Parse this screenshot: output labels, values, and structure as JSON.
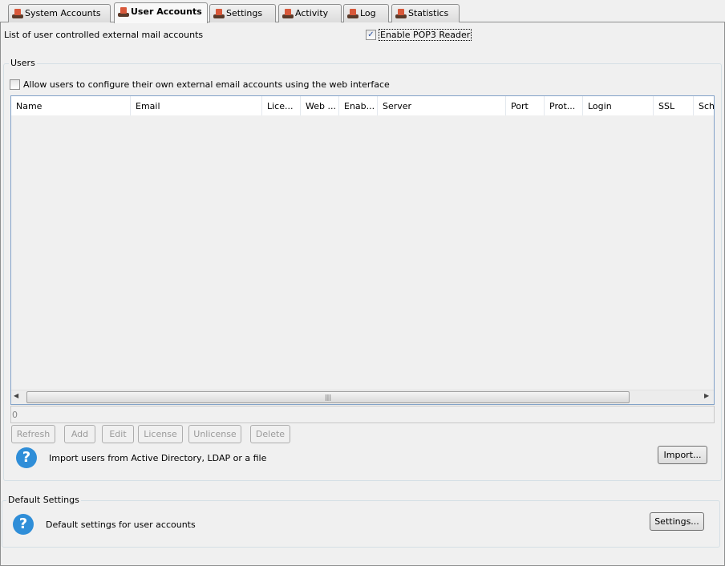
{
  "tabs": [
    {
      "label": "System Accounts"
    },
    {
      "label": "User Accounts",
      "active": true
    },
    {
      "label": "Settings"
    },
    {
      "label": "Activity"
    },
    {
      "label": "Log"
    },
    {
      "label": "Statistics"
    }
  ],
  "description": "List of user controlled external mail accounts",
  "enable_pop3": {
    "label": "Enable POP3 Reader",
    "checked": true
  },
  "users": {
    "legend": "Users",
    "allow_web": {
      "label": "Allow users to configure their own external email accounts using the web interface",
      "checked": false
    },
    "columns": [
      "Name",
      "Email",
      "Lice...",
      "Web ...",
      "Enab...",
      "Server",
      "Port",
      "Prot...",
      "Login",
      "SSL",
      "Sch"
    ],
    "count": "0",
    "buttons": {
      "refresh": "Refresh",
      "add": "Add",
      "edit": "Edit",
      "license": "License",
      "unlicense": "Unlicense",
      "delete": "Delete"
    },
    "import_text": "Import users from Active Directory, LDAP or a file",
    "import_button": "Import..."
  },
  "defaults": {
    "legend": "Default Settings",
    "text": "Default settings for user accounts",
    "button": "Settings..."
  },
  "help_glyph": "?"
}
